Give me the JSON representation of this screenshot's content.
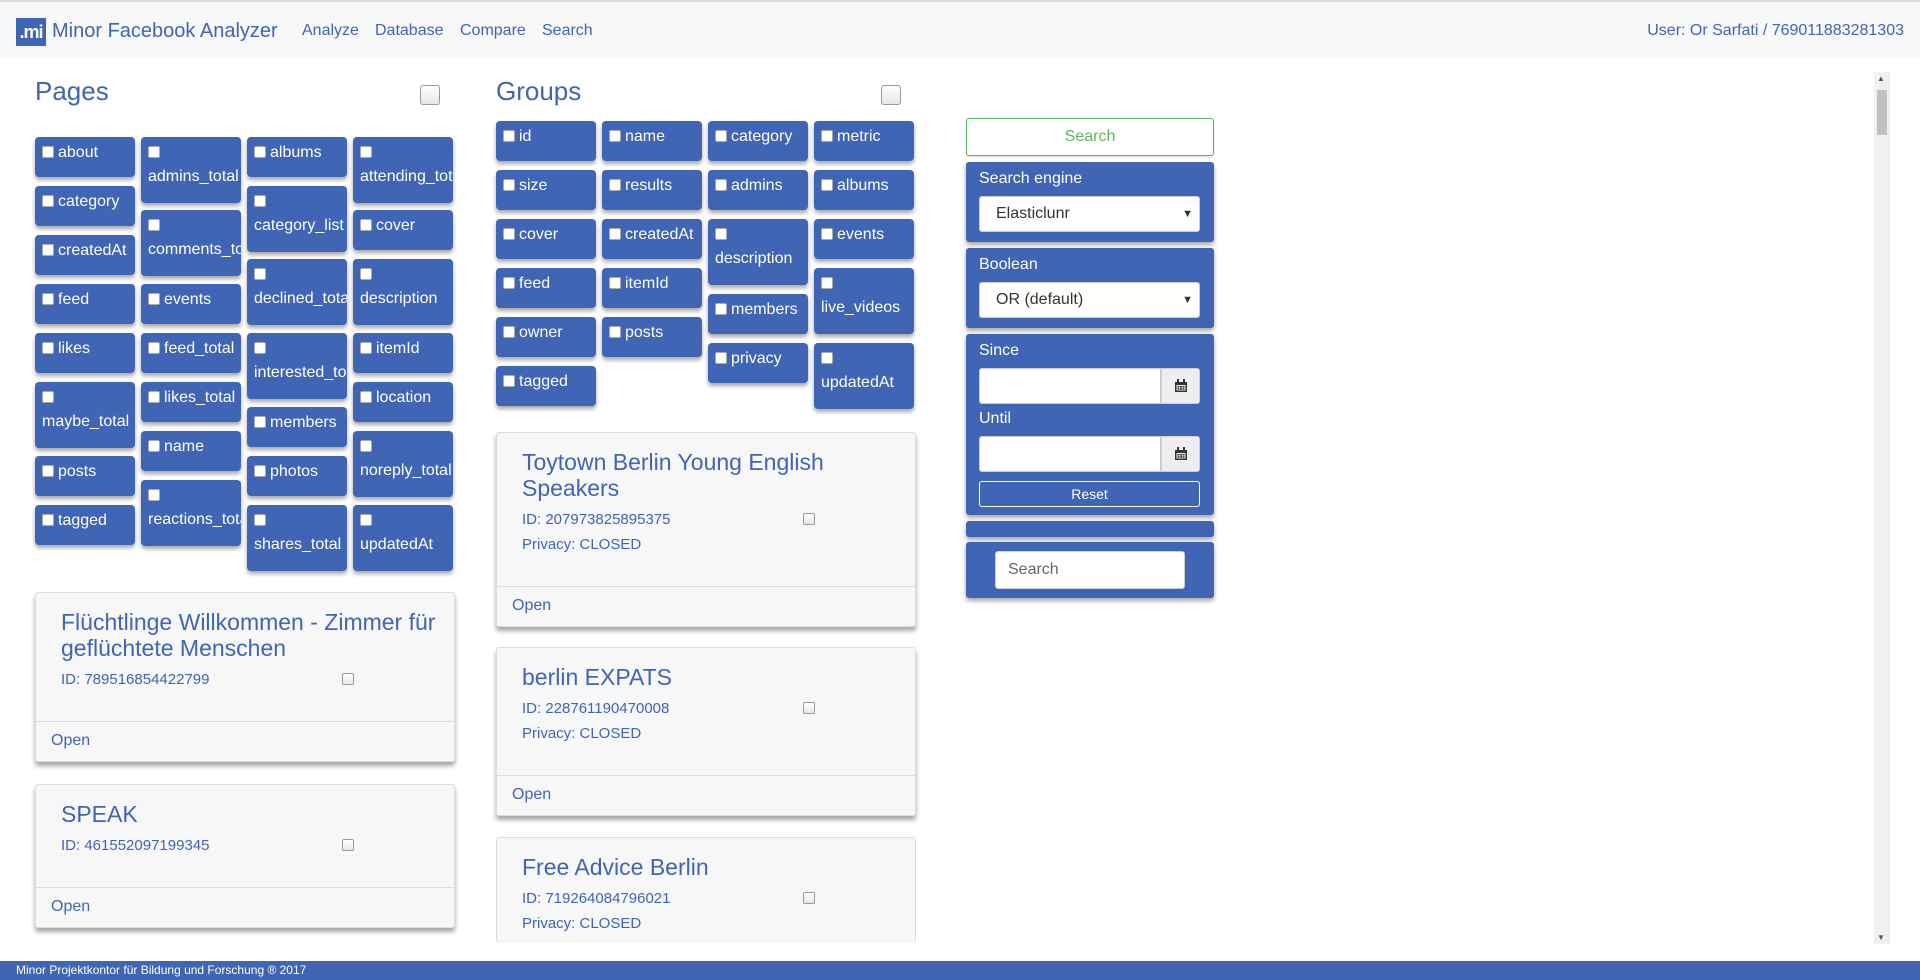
{
  "app": {
    "logo_text": ".mi",
    "title": "Minor Facebook Analyzer",
    "nav": [
      "Analyze",
      "Database",
      "Compare",
      "Search"
    ],
    "user": "User: Or Sarfati / 769011883281303"
  },
  "pages": {
    "title": "Pages",
    "fields": [
      "about",
      "admins_total",
      "albums",
      "attending_total",
      "category",
      "category_list",
      "comments_total",
      "cover",
      "createdAt",
      "declined_total",
      "description",
      "feed",
      "events",
      "interested_total",
      "itemId",
      "likes",
      "feed_total",
      "location",
      "members",
      "maybe_total",
      "likes_total",
      "noreply_total",
      "photos",
      "posts",
      "name",
      "reactions_total",
      "shares_total",
      "tagged",
      "updatedAt"
    ],
    "results": [
      {
        "title": "Flüchtlinge Willkommen - Zimmer für geflüchtete Menschen",
        "id": "ID: 789516854422799",
        "open": "Open"
      },
      {
        "title": "SPEAK",
        "id": "ID: 461552097199345",
        "open": "Open"
      }
    ]
  },
  "groups": {
    "title": "Groups",
    "fields": [
      "id",
      "name",
      "category",
      "metric",
      "size",
      "results",
      "admins",
      "albums",
      "cover",
      "createdAt",
      "description",
      "events",
      "feed",
      "itemId",
      "live_videos",
      "members",
      "owner",
      "posts",
      "privacy",
      "tagged",
      "updatedAt"
    ],
    "results": [
      {
        "title": "Toytown Berlin Young English Speakers",
        "id": "ID: 207973825895375",
        "privacy": "Privacy: CLOSED",
        "open": "Open"
      },
      {
        "title": "berlin EXPATS",
        "id": "ID: 228761190470008",
        "privacy": "Privacy: CLOSED",
        "open": "Open"
      },
      {
        "title": "Free Advice Berlin",
        "id": "ID: 719264084796021",
        "privacy": "Privacy: CLOSED"
      }
    ]
  },
  "search": {
    "button": "Search",
    "engine_label": "Search engine",
    "engine_value": "Elasticlunr",
    "boolean_label": "Boolean",
    "boolean_value": "OR (default)",
    "since_label": "Since",
    "until_label": "Until",
    "reset": "Reset",
    "text_placeholder": "Search"
  },
  "footer": "Minor Projektkontor für Bildung und Forschung ® 2017",
  "colors": {
    "primary": "#3f65b4",
    "success": "#5cb85c"
  }
}
